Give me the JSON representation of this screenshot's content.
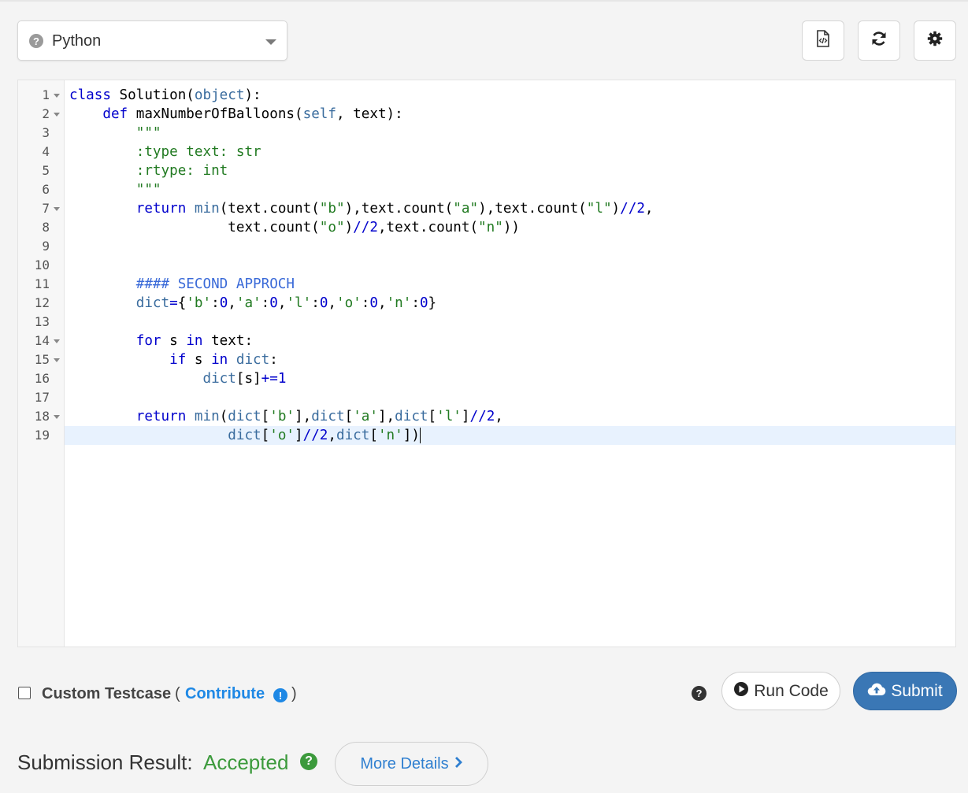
{
  "language": {
    "selected": "Python",
    "help_icon": "question-circle-icon",
    "caret_icon": "caret-down-icon"
  },
  "toolbar": {
    "buttons": [
      {
        "name": "code-file-icon"
      },
      {
        "name": "refresh-icon"
      },
      {
        "name": "gear-icon"
      }
    ]
  },
  "editor": {
    "active_line": 19,
    "line_numbers": [
      "1",
      "2",
      "3",
      "4",
      "5",
      "6",
      "7",
      "8",
      "9",
      "10",
      "11",
      "12",
      "13",
      "14",
      "15",
      "16",
      "17",
      "18",
      "19"
    ],
    "foldable_lines": [
      1,
      2,
      7,
      14,
      15,
      18
    ],
    "lines": [
      "class Solution(object):",
      "    def maxNumberOfBalloons(self, text):",
      "        \"\"\"",
      "        :type text: str",
      "        :rtype: int",
      "        \"\"\"",
      "        return min(text.count(\"b\"),text.count(\"a\"),text.count(\"l\")//2,",
      "                   text.count(\"o\")//2,text.count(\"n\"))",
      "",
      "",
      "        #### SECOND APPROCH",
      "        dict={'b':0,'a':0,'l':0,'o':0,'n':0}",
      "",
      "        for s in text:",
      "            if s in dict:",
      "                dict[s]+=1",
      "",
      "        return min(dict['b'],dict['a'],dict['l']//2,",
      "                   dict['o']//2,dict['n'])"
    ]
  },
  "custom_testcase": {
    "checked": false,
    "label": "Custom Testcase",
    "open_paren": "(",
    "contribute_label": "Contribute",
    "close_paren": ")"
  },
  "actions": {
    "run_label": "Run Code",
    "submit_label": "Submit"
  },
  "result": {
    "label": "Submission Result:",
    "status": "Accepted",
    "more_details_label": "More Details"
  },
  "colors": {
    "accepted": "#3c9a3c",
    "submit_bg": "#3a77b5",
    "link": "#1e88e5"
  }
}
